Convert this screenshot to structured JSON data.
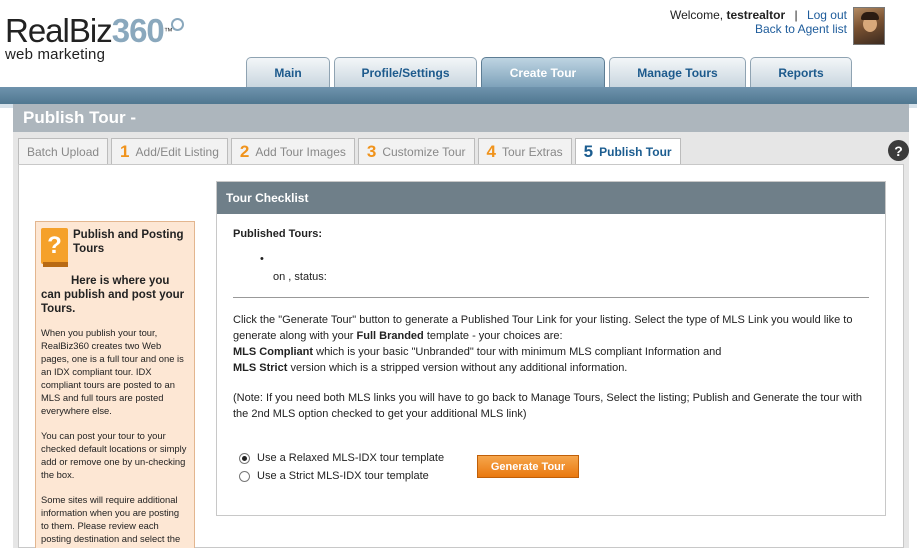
{
  "brand": {
    "name_main": "RealBiz",
    "name_num": "360",
    "trademark": "™",
    "tagline": "web marketing"
  },
  "user": {
    "welcome_prefix": "Welcome,",
    "username": "testrealtor",
    "separator": "|",
    "logout": "Log out",
    "back_to_agent": "Back to Agent list"
  },
  "nav": {
    "tabs": [
      {
        "label": "Main"
      },
      {
        "label": "Profile/Settings"
      },
      {
        "label": "Create Tour",
        "active": true
      },
      {
        "label": "Manage Tours"
      },
      {
        "label": "Reports"
      }
    ]
  },
  "page": {
    "title": "Publish Tour -"
  },
  "steps": [
    {
      "num": "",
      "label": "Batch Upload"
    },
    {
      "num": "1",
      "label": "Add/Edit Listing"
    },
    {
      "num": "2",
      "label": "Add Tour Images"
    },
    {
      "num": "3",
      "label": "Customize Tour"
    },
    {
      "num": "4",
      "label": "Tour Extras"
    },
    {
      "num": "5",
      "label": "Publish Tour",
      "active": true
    }
  ],
  "help_icon": "?",
  "info_panel": {
    "icon_glyph": "?",
    "title": "Publish and Posting Tours",
    "lead": "Here is where you can publish and post your Tours.",
    "paragraphs": [
      "When you publish your tour, RealBiz360 creates two Web pages, one is a full tour and one is an IDX compliant tour. IDX compliant tours are posted to an MLS and full tours are posted everywhere else.",
      "You can post your tour to your checked default locations or simply add or remove one by un-checking the box.",
      "Some sites will require additional information when you are posting to them. Please review each posting destination and select the"
    ]
  },
  "checklist": {
    "header": "Tour Checklist",
    "published_label": "Published Tours:",
    "bullet": "•",
    "on_status": "on , status:",
    "intro": "Click the \"Generate Tour\" button to generate a Published Tour Link for your listing. Select the type of MLS Link you would like to generate along with your",
    "intro_bold": "Full Branded",
    "intro_tail": "template - your choices are:",
    "mls_compliant_bold": "MLS Compliant",
    "mls_compliant_text": "which is your basic \"Unbranded\" tour with minimum MLS compliant Information and",
    "mls_strict_bold": "MLS Strict",
    "mls_strict_text": "version which is a stripped version without any additional information.",
    "note": "(Note: If you need both MLS links you will have to go back to Manage Tours, Select the listing; Publish and Generate the tour with the 2nd MLS option checked to get your additional MLS link)",
    "options": [
      {
        "label": "Use a Relaxed MLS-IDX tour template",
        "selected": true
      },
      {
        "label": "Use a Strict MLS-IDX tour template",
        "selected": false
      }
    ],
    "generate_button": "Generate Tour"
  },
  "colors": {
    "accent_orange": "#f0931c",
    "link_blue": "#1e5c9b",
    "nav_bar": "#5a7f97",
    "info_bg": "#fde7d4",
    "checklist_header": "#6f7f89"
  }
}
